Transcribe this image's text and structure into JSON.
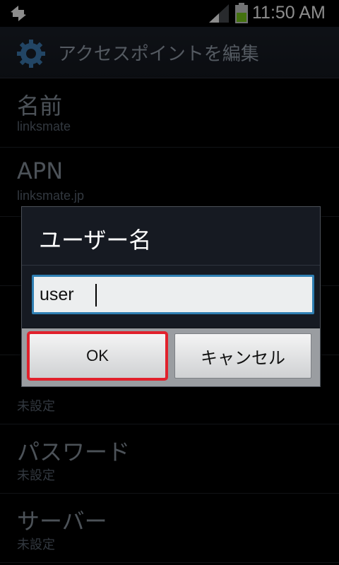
{
  "status_bar": {
    "time": "11:50 AM"
  },
  "header": {
    "title": "アクセスポイントを編集"
  },
  "list": [
    {
      "label": "名前",
      "value": "linksmate"
    },
    {
      "label": "APN",
      "value": "linksmate.jp"
    },
    {
      "label": "",
      "value": ""
    },
    {
      "label": "",
      "value": ""
    },
    {
      "label": "",
      "value": "未設定"
    },
    {
      "label": "パスワード",
      "value": "未設定"
    },
    {
      "label": "サーバー",
      "value": "未設定"
    }
  ],
  "dialog": {
    "title": "ユーザー名",
    "input_value": "user",
    "ok_label": "OK",
    "cancel_label": "キャンセル"
  },
  "colors": {
    "accent_input_border": "#2f7fb3",
    "highlight_red": "#e1212c",
    "battery_green": "#7dcf1d"
  },
  "icons": {
    "status_left": "sync-icon",
    "header": "gear-icon"
  }
}
